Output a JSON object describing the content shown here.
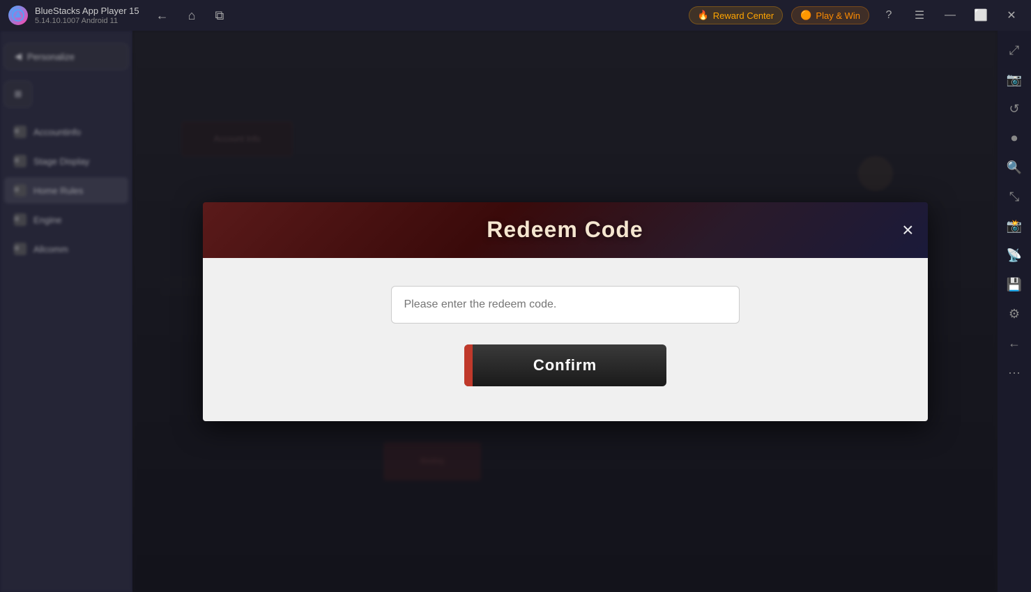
{
  "titleBar": {
    "appName": "BlueStacks App Player 15",
    "version": "5.14.10.1007  Android 11",
    "rewardCenter": "Reward Center",
    "playWin": "Play & Win",
    "navBack": "←",
    "navHome": "⌂",
    "navTabs": "⧉"
  },
  "rightSidebar": {
    "icons": [
      {
        "name": "expand-icon",
        "glyph": "⤢"
      },
      {
        "name": "screenshot-icon",
        "glyph": "📷"
      },
      {
        "name": "refresh-icon",
        "glyph": "↻"
      },
      {
        "name": "record-icon",
        "glyph": "⏺"
      },
      {
        "name": "zoom-icon",
        "glyph": "🔍"
      },
      {
        "name": "resize-icon",
        "glyph": "⤡"
      },
      {
        "name": "camera-icon",
        "glyph": "📸"
      },
      {
        "name": "wifi-icon",
        "glyph": "📡"
      },
      {
        "name": "save-icon",
        "glyph": "💾"
      },
      {
        "name": "settings-icon",
        "glyph": "⚙"
      },
      {
        "name": "back-icon",
        "glyph": "←"
      },
      {
        "name": "more-icon",
        "glyph": "…"
      }
    ]
  },
  "modal": {
    "title": "Redeem Code",
    "closeLabel": "×",
    "inputPlaceholder": "Please enter the redeem code.",
    "confirmLabel": "Confirm"
  },
  "sidebar": {
    "items": [
      {
        "label": "Accountinfo",
        "icon": "≡"
      },
      {
        "label": "Stage Display",
        "icon": "≡"
      },
      {
        "label": "Home Rules",
        "icon": "≡",
        "active": true
      },
      {
        "label": "Engine",
        "icon": "≡"
      },
      {
        "label": "Allcomm",
        "icon": "≡"
      }
    ]
  },
  "toolbar": {
    "btn1": "Personalize",
    "btn2": "⊞"
  },
  "colors": {
    "modalHeaderBg": "#5a1a1a",
    "confirmBtnBg": "#1a1a1a",
    "confirmRedBar": "#c0392b",
    "titleColor": "#f5e6d0"
  }
}
